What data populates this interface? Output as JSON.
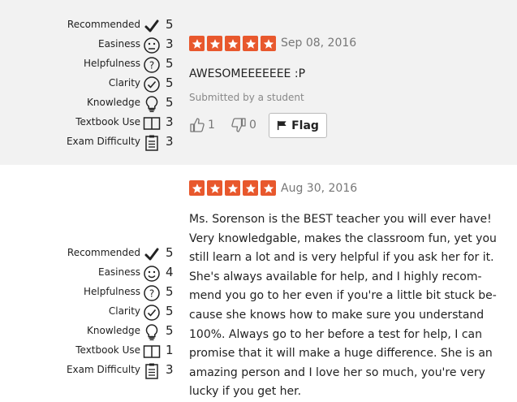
{
  "rating_labels": {
    "recommended": "Recommended",
    "easiness": "Easiness",
    "helpfulness": "Helpfulness",
    "clarity": "Clarity",
    "knowledge": "Knowledge",
    "textbook": "Textbook Use",
    "exam": "Exam Difficulty"
  },
  "icons": [
    "checkmark-icon",
    "smiley-icon",
    "question-circle-icon",
    "check-circle-icon",
    "lightbulb-icon",
    "book-icon",
    "clipboard-icon"
  ],
  "colors": {
    "star": "#e8582d",
    "shaded_bg": "#f2f2f2"
  },
  "reviews": [
    {
      "stars": 5,
      "date": "Sep 08, 2016",
      "comment": "AWESOMEEEEEEE :P",
      "submitted": "Submitted by a student",
      "thumbs_up": "1",
      "thumbs_down": "0",
      "flag_label": "Flag",
      "ratings": {
        "recommended": "5",
        "easiness": "3",
        "helpfulness": "5",
        "clarity": "5",
        "knowledge": "5",
        "textbook": "3",
        "exam": "3"
      }
    },
    {
      "stars": 5,
      "date": "Aug 30, 2016",
      "comment_lines": [
        "Ms. Sorenson is the BEST teacher you will ever have!",
        "Very knowledgable, makes the classroom fun, yet you",
        "still learn a lot and is very helpful if you ask her for it.",
        "She's always available for help, and I highly recom-",
        "mend you go to her even if you're a little bit stuck be-",
        "cause she knows how to make sure you understand",
        "100%. Always go to her before a test for help, I can",
        "promise that it will make a huge difference. She is an",
        "amazing person and I love her so much, you're very",
        "lucky if you get her."
      ],
      "ratings": {
        "recommended": "5",
        "easiness": "4",
        "helpfulness": "5",
        "clarity": "5",
        "knowledge": "5",
        "textbook": "1",
        "exam": "3"
      }
    }
  ]
}
